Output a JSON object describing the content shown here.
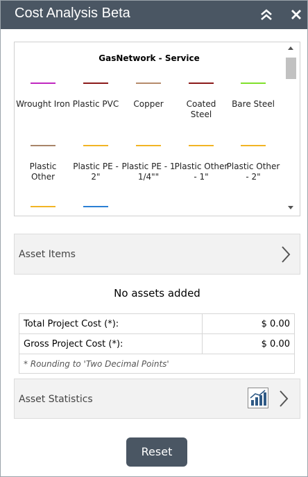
{
  "header": {
    "title": "Cost Analysis Beta",
    "collapse_icon": "double-chevron-up-icon",
    "close_icon": "close-icon",
    "bg_color": "#4a5663"
  },
  "legend": {
    "title": "GasNetwork - Service",
    "items": [
      {
        "label": "Wrought Iron",
        "color": "#c026c0"
      },
      {
        "label": "Plastic PVC",
        "color": "#8b1a1a"
      },
      {
        "label": "Copper",
        "color": "#b58a6a"
      },
      {
        "label": "Coated Steel",
        "color": "#8b1a1a"
      },
      {
        "label": "Bare Steel",
        "color": "#7fe02a"
      },
      {
        "label": "Plastic Other",
        "color": "#a88468"
      },
      {
        "label": "Plastic PE - 2\"",
        "color": "#f2b424"
      },
      {
        "label": "Plastic PE - 1 1/4\"\"",
        "color": "#f2b424"
      },
      {
        "label": "Plastic Other - 1\"",
        "color": "#f2b424"
      },
      {
        "label": "Plastic Other - 2\"",
        "color": "#f2b424"
      },
      {
        "label": "",
        "color": "#f2b424"
      },
      {
        "label": "",
        "color": "#2a7fd4"
      }
    ]
  },
  "asset_items": {
    "label": "Asset Items",
    "empty_text": "No assets added"
  },
  "costs": {
    "rows": [
      {
        "label": "Total Project Cost (*):",
        "value": "$ 0.00"
      },
      {
        "label": "Gross Project Cost (*):",
        "value": "$ 0.00"
      }
    ],
    "note": "* Rounding to 'Two Decimal Points'"
  },
  "asset_statistics": {
    "label": "Asset Statistics",
    "icon": "bar-chart-icon"
  },
  "reset_label": "Reset"
}
